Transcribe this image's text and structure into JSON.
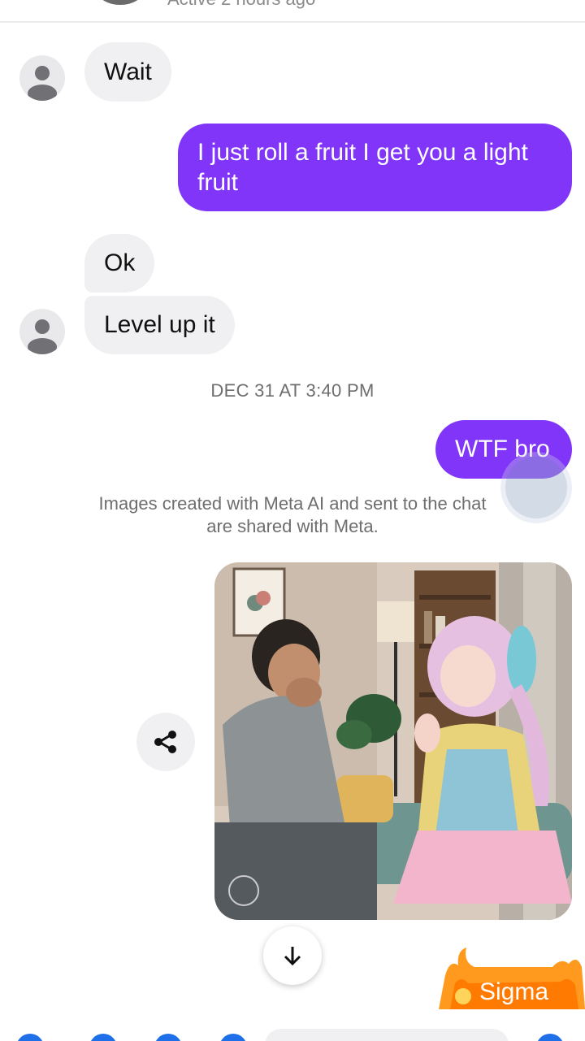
{
  "header": {
    "status": "Active 2 hours ago"
  },
  "messages": [
    {
      "side": "in",
      "text": "Wait"
    },
    {
      "side": "out",
      "text": "I just roll a fruit I get you a light fruit"
    },
    {
      "side": "in",
      "text": "Ok"
    },
    {
      "side": "in",
      "text": "Level up it"
    },
    {
      "side": "out",
      "text": "WTF bro"
    }
  ],
  "timestamp": "DEC 31 AT 3:40 PM",
  "notice": "Images created with Meta AI and sent to the chat are shared with Meta.",
  "sticker": {
    "label": "Sigma"
  },
  "colors": {
    "outgoing_bubble": "#8035f8",
    "incoming_bubble": "#f0f0f2",
    "accent": "#1e6fe8"
  },
  "icons": {
    "share": "share-icon",
    "scroll_down": "arrow-down-icon",
    "avatar": "person-icon"
  }
}
